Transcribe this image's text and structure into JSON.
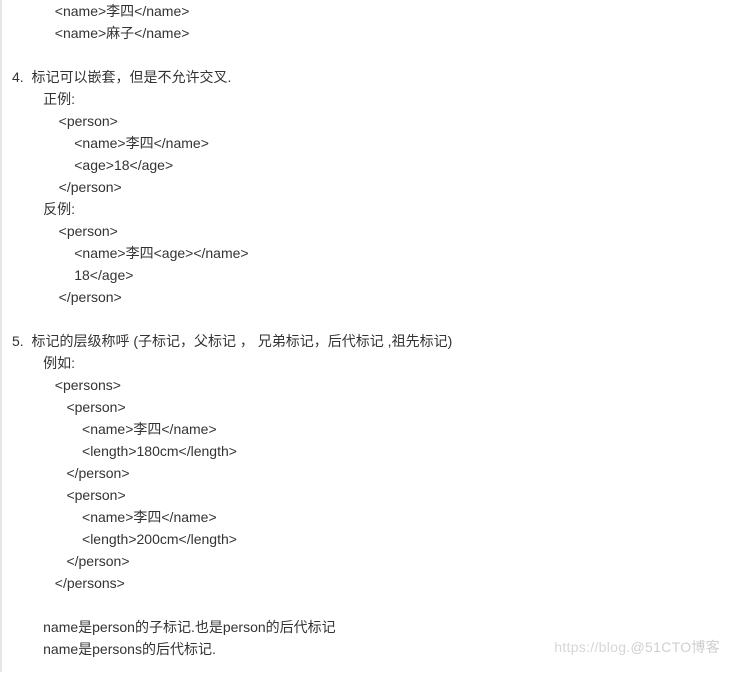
{
  "lines": [
    "           <name>李四</name>",
    "           <name>麻子</name>",
    "",
    "4.  标记可以嵌套，但是不允许交叉.",
    "        正例:",
    "            <person>",
    "                <name>李四</name>",
    "                <age>18</age>",
    "            </person>",
    "        反例:",
    "            <person>",
    "                <name>李四<age></name>",
    "                18</age>",
    "            </person>",
    "",
    "5.  标记的层级称呼 (子标记，父标记 ， 兄弟标记，后代标记 ,祖先标记)",
    "        例如:",
    "           <persons>",
    "              <person>",
    "                  <name>李四</name>",
    "                  <length>180cm</length>",
    "              </person>",
    "              <person>",
    "                  <name>李四</name>",
    "                  <length>200cm</length>",
    "              </person>",
    "           </persons>",
    "",
    "        name是person的子标记.也是person的后代标记",
    "        name是persons的后代标记."
  ],
  "watermark": {
    "left": "https://blog.",
    "right": "@51CTO博客"
  }
}
